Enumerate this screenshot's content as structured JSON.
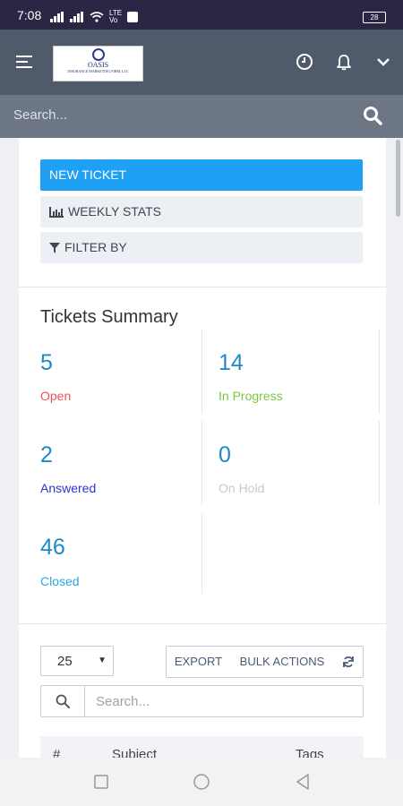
{
  "status_bar": {
    "time": "7:08",
    "network_top": "LTE",
    "network_bottom": "Vo",
    "battery": "28",
    "icons": [
      "signal-icon",
      "signal-icon",
      "wifi-icon",
      "volte-icon",
      "app-notification-icon"
    ]
  },
  "header": {
    "logo_title": "OASIS",
    "logo_subtitle": "INSURANCE MARKETING FIRM, LLC",
    "icons": [
      "menu-icon",
      "clock-icon",
      "bell-icon",
      "chevron-down-icon"
    ]
  },
  "search": {
    "placeholder": "Search..."
  },
  "actions": {
    "new_ticket": "NEW TICKET",
    "weekly_stats": "WEEKLY STATS",
    "filter_by": "FILTER BY"
  },
  "summary": {
    "title": "Tickets Summary",
    "stats": [
      {
        "count": "5",
        "label": "Open",
        "color": "#f0505a"
      },
      {
        "count": "14",
        "label": "In Progress",
        "color": "#7ac943"
      },
      {
        "count": "2",
        "label": "Answered",
        "color": "#2b35d0"
      },
      {
        "count": "0",
        "label": "On Hold",
        "color": "#c5cad0"
      },
      {
        "count": "46",
        "label": "Closed",
        "color": "#28a8e0"
      }
    ]
  },
  "table": {
    "page_size": "25",
    "export_label": "EXPORT",
    "bulk_actions_label": "BULK ACTIONS",
    "search_placeholder": "Search...",
    "columns": [
      "#",
      "Subject",
      "Tags"
    ]
  },
  "colors": {
    "accent": "#1ea0f5",
    "status_bar": "#2a2744",
    "app_bar": "#4f5a6a",
    "stat_number": "#1e88c8"
  }
}
